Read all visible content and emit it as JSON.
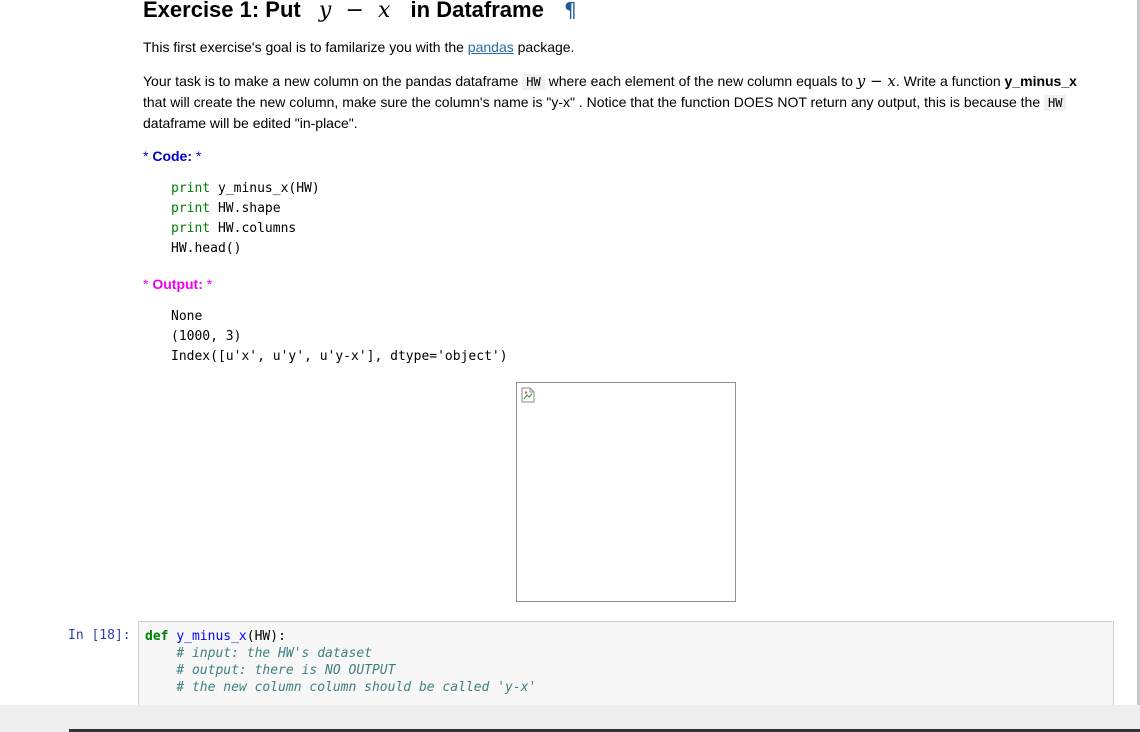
{
  "heading": {
    "prefix": "Exercise 1: Put",
    "math_y": "y",
    "math_minus": "−",
    "math_x": "x",
    "suffix": "in Dataframe",
    "anchor": "¶"
  },
  "intro": {
    "before_link": "This first exercise's goal is to familarize you with the ",
    "link_text": "pandas",
    "after_link": " package."
  },
  "task": {
    "t1": "Your task is to make a new column on the pandas dataframe ",
    "code1": "HW",
    "t2": " where each element of the new column equals to ",
    "math_y": "y",
    "math_minus": " − ",
    "math_x": "x",
    "t3": ". Write a function ",
    "func_bold": "y_minus_x",
    "t4": "that will create the new column, make sure the column's name is \"y-x\" . Notice that the function DOES NOT return any output, this is because the ",
    "code2": "HW",
    "t5": "dataframe will be edited \"in-place\"."
  },
  "code_section": {
    "star": "*",
    "label": "Code:",
    "lines": [
      {
        "kw": "print",
        "rest": " y_minus_x(HW)"
      },
      {
        "kw": "print",
        "rest": " HW.shape"
      },
      {
        "kw": "print",
        "rest": " HW.columns"
      },
      {
        "kw": "",
        "rest": "HW.head()"
      }
    ]
  },
  "output_section": {
    "star": "*",
    "label": "Output:",
    "lines": [
      "None",
      "(1000, 3)",
      "Index([u'x', u'y', u'y-x'], dtype='object')"
    ]
  },
  "cell": {
    "prompt": "In [18]:",
    "def_kw": "def",
    "func_name": "y_minus_x",
    "params": "(HW):",
    "comments": [
      "# input: the HW's dataset",
      "# output: there is NO OUTPUT",
      "# the new column column should be called 'y-x'"
    ]
  },
  "colors": {
    "code_label": "#0000cc",
    "output_label": "#ee00ee",
    "print_keyword": "#008000",
    "link": "#296eaa",
    "prompt": "#303f9f"
  },
  "icons": [
    "broken-image-icon",
    "anchor-pilcrow-icon"
  ]
}
